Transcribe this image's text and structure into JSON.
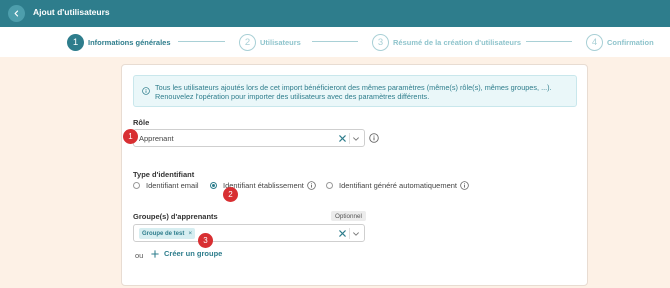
{
  "header": {
    "title": "Ajout d'utilisateurs"
  },
  "stepper": {
    "steps": [
      {
        "number": "1",
        "label": "Informations générales",
        "active": true
      },
      {
        "number": "2",
        "label": "Utilisateurs",
        "active": false
      },
      {
        "number": "3",
        "label": "Résumé de la création d'utilisateurs",
        "active": false
      },
      {
        "number": "4",
        "label": "Confirmation",
        "active": false
      }
    ]
  },
  "info": {
    "line1": "Tous les utilisateurs ajoutés lors de cet import bénéficieront des mêmes paramètres (même(s) rôle(s), mêmes groupes, ...).",
    "line2": "Renouvelez l'opération pour importer des utilisateurs avec des paramètres différents."
  },
  "role": {
    "label": "Rôle",
    "value": "Apprenant"
  },
  "identifier": {
    "label": "Type d'identifiant",
    "options": [
      {
        "label": "Identifiant email",
        "selected": false
      },
      {
        "label": "Identifiant établissement",
        "selected": true
      },
      {
        "label": "Identifiant généré automatiquement",
        "selected": false
      }
    ]
  },
  "groups": {
    "label": "Groupe(s) d'apprenants",
    "optional": "Optionnel",
    "tags": [
      "Groupe de test"
    ],
    "tag_remove": "×"
  },
  "create_group": {
    "or_text": "ou",
    "label": "Créer un groupe"
  },
  "badges": [
    "1",
    "2",
    "3"
  ],
  "colors": {
    "primary": "#2e7d8c",
    "badge": "#d82f32",
    "page_bg": "#fdf1e6",
    "info_bg": "#eaf7f9"
  },
  "icons": {
    "back": "chevron-left-icon",
    "info": "info-circle-icon",
    "help": "info-circle-icon",
    "clear": "close-icon",
    "dropdown": "chevron-down-icon",
    "add": "plus-icon"
  }
}
